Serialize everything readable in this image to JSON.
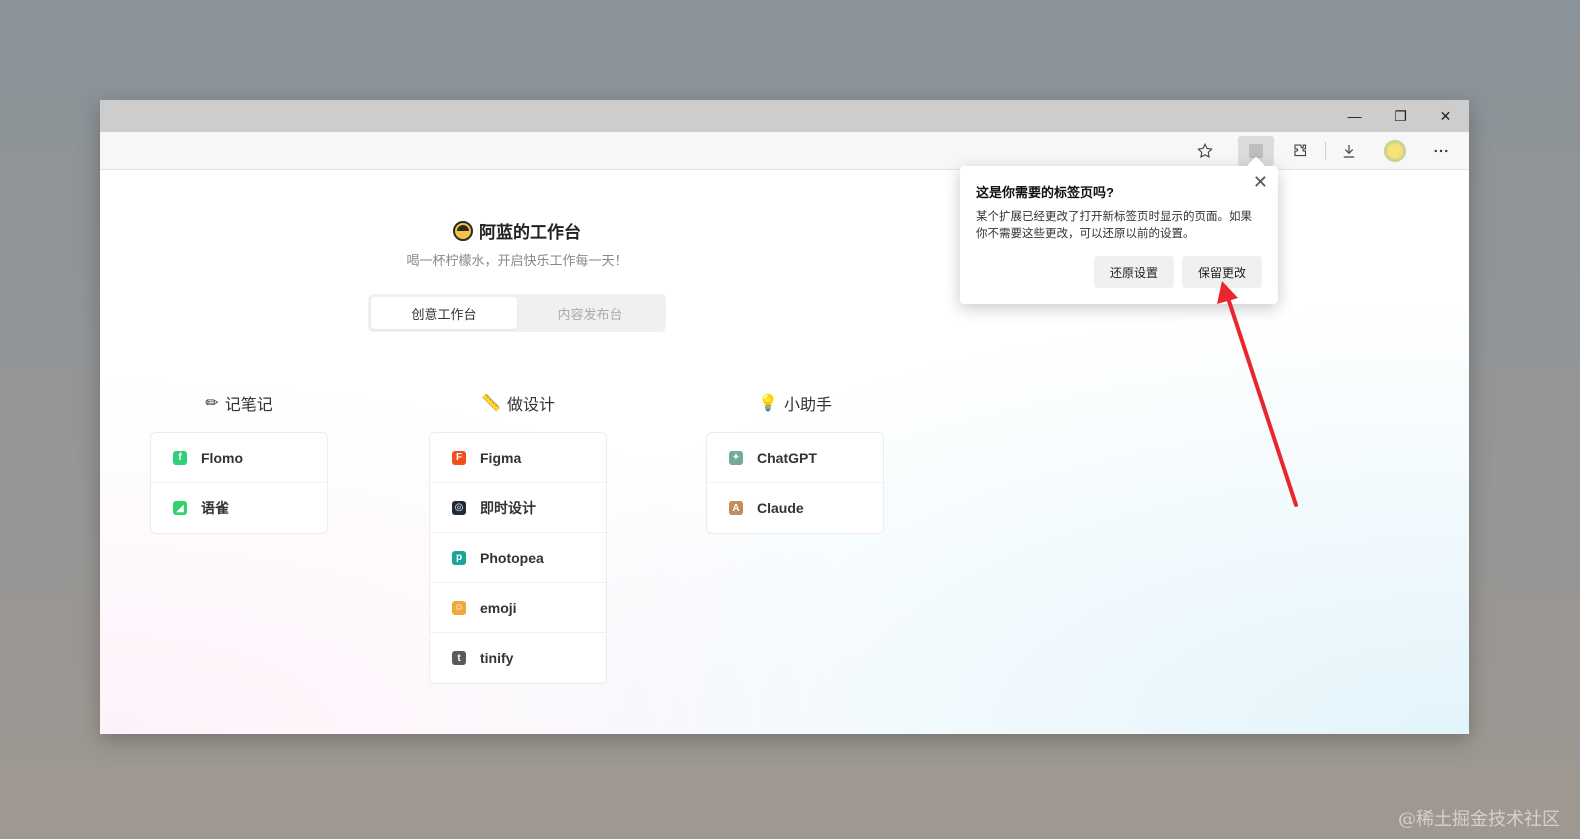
{
  "browser": {
    "window_controls": {
      "minimize": "—",
      "restore": "❐",
      "close": "✕"
    },
    "toolbar_icons": [
      "star-icon",
      "newtab-extension-icon",
      "extensions-icon",
      "download-icon",
      "profile-avatar",
      "more-icon"
    ]
  },
  "page": {
    "title": "阿蓝的工作台",
    "subtitle": "喝一杯柠檬水，开启快乐工作每一天！",
    "tabs": [
      {
        "label": "创意工作台",
        "active": true
      },
      {
        "label": "内容发布台",
        "active": false
      }
    ],
    "columns": [
      {
        "heading": "记笔记",
        "icon": "pencil-icon",
        "items": [
          {
            "label": "Flomo",
            "icon": "flomo-icon",
            "color": "#30cf79"
          },
          {
            "label": "语雀",
            "icon": "yuque-icon",
            "color": "#2ed36e"
          }
        ]
      },
      {
        "heading": "做设计",
        "icon": "ruler-icon",
        "items": [
          {
            "label": "Figma",
            "icon": "figma-icon",
            "color": "#f24e1e"
          },
          {
            "label": "即时设计",
            "icon": "jsdesign-icon",
            "color": "#1f2b3a"
          },
          {
            "label": "Photopea",
            "icon": "photopea-icon",
            "color": "#18a497"
          },
          {
            "label": "emoji",
            "icon": "emoji-icon",
            "color": "#f2a73b"
          },
          {
            "label": "tinify",
            "icon": "tinify-icon",
            "color": "#5b5b5b"
          }
        ]
      },
      {
        "heading": "小助手",
        "icon": "bulb-icon",
        "items": [
          {
            "label": "ChatGPT",
            "icon": "chatgpt-icon",
            "color": "#74aa9c"
          },
          {
            "label": "Claude",
            "icon": "claude-icon",
            "color": "#c48b5b"
          }
        ]
      }
    ]
  },
  "popup": {
    "title": "这是你需要的标签页吗?",
    "body": "某个扩展已经更改了打开新标签页时显示的页面。如果你不需要这些更改，可以还原以前的设置。",
    "restore_label": "还原设置",
    "keep_label": "保留更改"
  },
  "watermark": "@稀土掘金技术社区"
}
